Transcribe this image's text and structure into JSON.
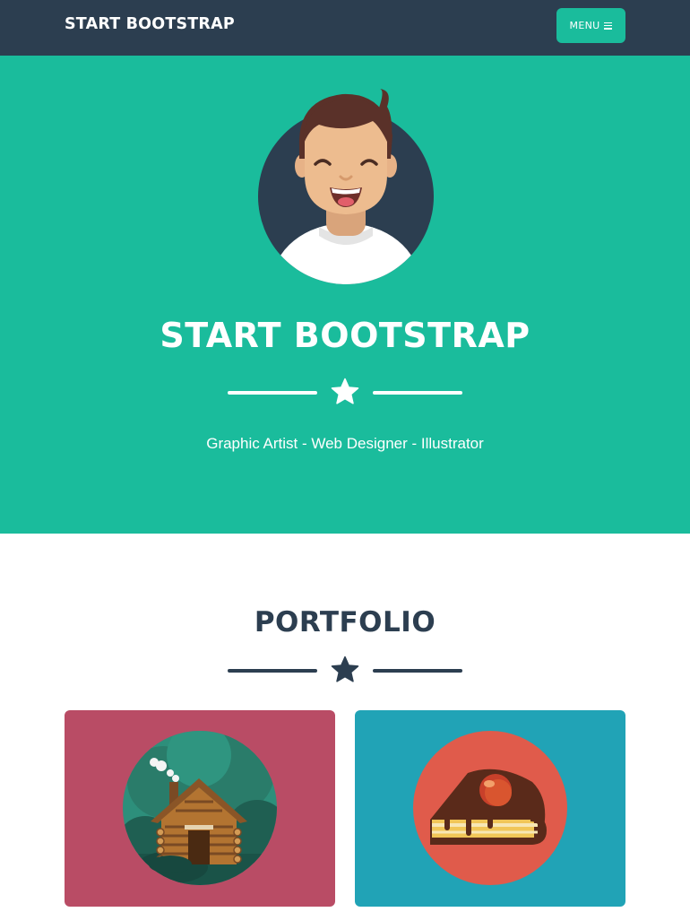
{
  "navbar": {
    "brand": "START BOOTSTRAP",
    "menu_label": "MENU",
    "menu_icon": "hamburger-icon"
  },
  "masthead": {
    "avatar_icon": "avatar-illustration",
    "title": "START BOOTSTRAP",
    "divider_icon": "star-icon",
    "subtitle": "Graphic Artist - Web Designer - Illustrator"
  },
  "portfolio": {
    "heading": "PORTFOLIO",
    "divider_icon": "star-icon",
    "items": [
      {
        "icon": "cabin-illustration",
        "background": "#b94c65"
      },
      {
        "icon": "cake-illustration",
        "background": "#21a3b6"
      }
    ]
  },
  "colors": {
    "navbar": "#2c3e50",
    "accent": "#1abc9c",
    "text_dark": "#2c3e50",
    "white": "#ffffff"
  }
}
